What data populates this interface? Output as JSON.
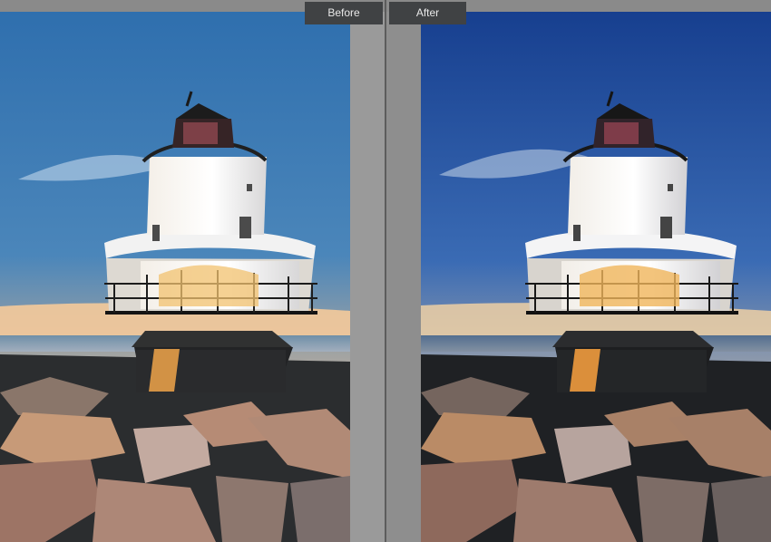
{
  "comparison": {
    "before_label": "Before",
    "after_label": "After"
  },
  "colors": {
    "before_sky_top": "#2f6fae",
    "before_sky_bottom": "#f2bf8d",
    "after_sky_top": "#173f8f",
    "after_sky_bottom": "#d7c2a5",
    "divider": "#9a9a9a",
    "label_bg": "#404244"
  }
}
